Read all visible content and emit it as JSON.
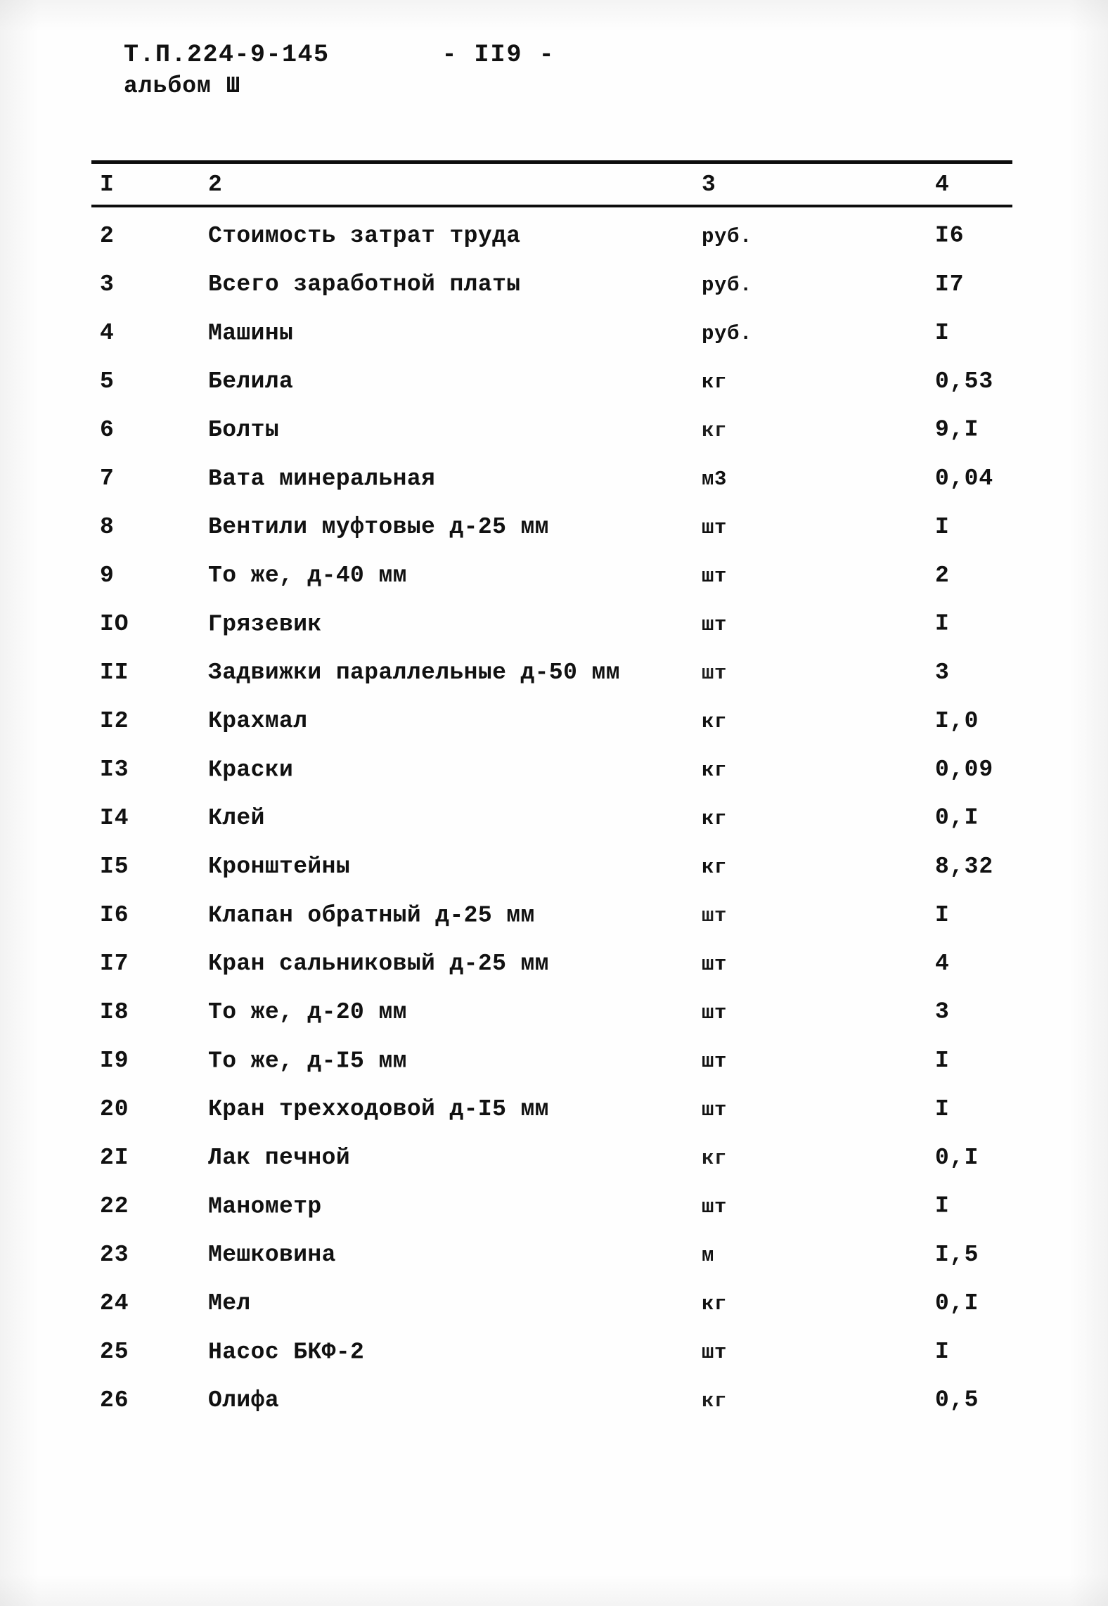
{
  "header": {
    "doc_code": "Т.П.224-9-145",
    "page_marker": "-  II9  -",
    "album": "альбом Ш"
  },
  "table": {
    "columns": [
      "I",
      "2",
      "3",
      "4"
    ],
    "rows": [
      {
        "num": "2",
        "name": "Стоимость затрат труда",
        "unit": "руб.",
        "qty": "I6"
      },
      {
        "num": "3",
        "name": "Всего заработной платы",
        "unit": "руб.",
        "qty": "I7"
      },
      {
        "num": "4",
        "name": "Машины",
        "unit": "руб.",
        "qty": "I"
      },
      {
        "num": "5",
        "name": "Белила",
        "unit": "кг",
        "qty": "0,53"
      },
      {
        "num": "6",
        "name": "Болты",
        "unit": "кг",
        "qty": "9,I"
      },
      {
        "num": "7",
        "name": "Вата минеральная",
        "unit": "м3",
        "qty": "0,04"
      },
      {
        "num": "8",
        "name": "Вентили муфтовые д-25 мм",
        "unit": "шт",
        "qty": "I"
      },
      {
        "num": "9",
        "name": "То же, д-40 мм",
        "unit": "шт",
        "qty": "2"
      },
      {
        "num": "IO",
        "name": "Грязевик",
        "unit": "шт",
        "qty": "I"
      },
      {
        "num": "II",
        "name": "Задвижки параллельные д-50 мм",
        "unit": "шт",
        "qty": "3"
      },
      {
        "num": "I2",
        "name": "Крахмал",
        "unit": "кг",
        "qty": "I,0"
      },
      {
        "num": "I3",
        "name": "Краски",
        "unit": "кг",
        "qty": "0,09"
      },
      {
        "num": "I4",
        "name": "Клей",
        "unit": "кг",
        "qty": "0,I"
      },
      {
        "num": "I5",
        "name": "Кронштейны",
        "unit": "кг",
        "qty": "8,32"
      },
      {
        "num": "I6",
        "name": "Клапан обратный д-25 мм",
        "unit": "шт",
        "qty": "I"
      },
      {
        "num": "I7",
        "name": "Кран сальниковый д-25 мм",
        "unit": "шт",
        "qty": "4"
      },
      {
        "num": "I8",
        "name": "То же, д-20 мм",
        "unit": "шт",
        "qty": "3"
      },
      {
        "num": "I9",
        "name": "То же, д-I5 мм",
        "unit": "шт",
        "qty": "I"
      },
      {
        "num": "20",
        "name": "Кран трехходовой д-I5 мм",
        "unit": "шт",
        "qty": "I"
      },
      {
        "num": "2I",
        "name": "Лак печной",
        "unit": "кг",
        "qty": "0,I"
      },
      {
        "num": "22",
        "name": "Манометр",
        "unit": "шт",
        "qty": "I"
      },
      {
        "num": "23",
        "name": "Мешковина",
        "unit": "м",
        "qty": "I,5"
      },
      {
        "num": "24",
        "name": "Мел",
        "unit": "кг",
        "qty": "0,I"
      },
      {
        "num": "25",
        "name": "Насос БКФ-2",
        "unit": "шт",
        "qty": "I"
      },
      {
        "num": "26",
        "name": "Олифа",
        "unit": "кг",
        "qty": "0,5"
      }
    ]
  }
}
